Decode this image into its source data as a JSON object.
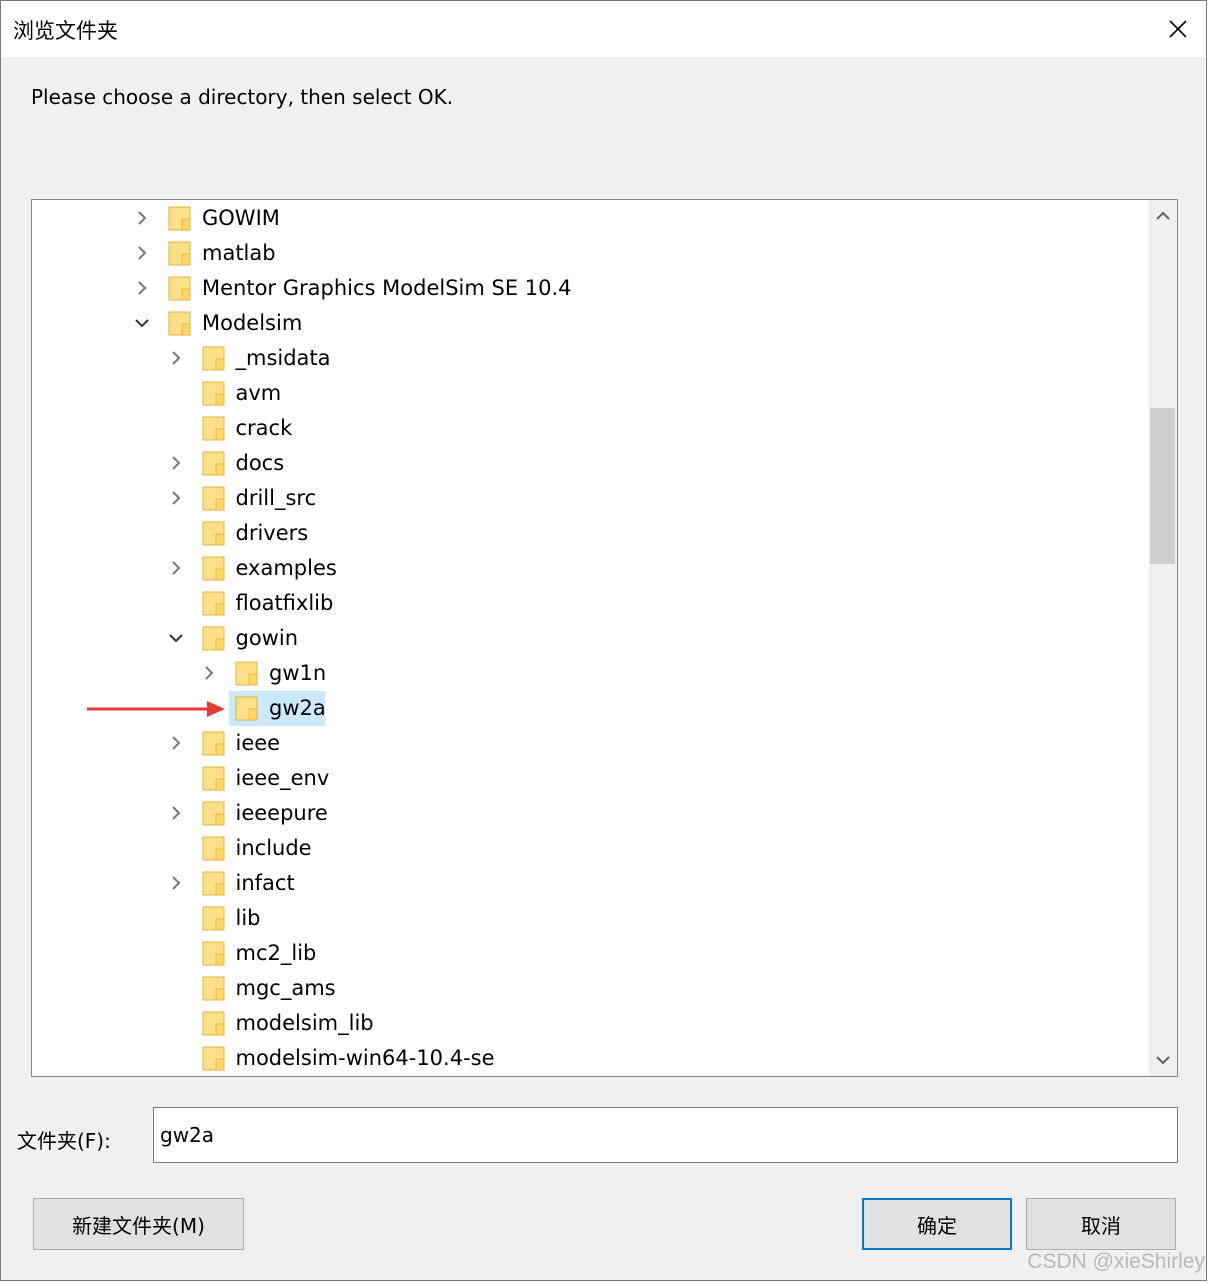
{
  "window": {
    "title": "浏览文件夹",
    "instruction": "Please choose a directory, then select OK."
  },
  "tree": {
    "items": [
      {
        "label": "GOWIM",
        "level": 0,
        "expander": "collapsed",
        "selected": false
      },
      {
        "label": "matlab",
        "level": 0,
        "expander": "collapsed",
        "selected": false
      },
      {
        "label": "Mentor Graphics ModelSim SE 10.4",
        "level": 0,
        "expander": "collapsed",
        "selected": false
      },
      {
        "label": "Modelsim",
        "level": 0,
        "expander": "expanded",
        "selected": false
      },
      {
        "label": "_msidata",
        "level": 1,
        "expander": "collapsed",
        "selected": false
      },
      {
        "label": "avm",
        "level": 1,
        "expander": "none",
        "selected": false
      },
      {
        "label": "crack",
        "level": 1,
        "expander": "none",
        "selected": false
      },
      {
        "label": "docs",
        "level": 1,
        "expander": "collapsed",
        "selected": false
      },
      {
        "label": "drill_src",
        "level": 1,
        "expander": "collapsed",
        "selected": false
      },
      {
        "label": "drivers",
        "level": 1,
        "expander": "none",
        "selected": false
      },
      {
        "label": "examples",
        "level": 1,
        "expander": "collapsed",
        "selected": false
      },
      {
        "label": "floatfixlib",
        "level": 1,
        "expander": "none",
        "selected": false
      },
      {
        "label": "gowin",
        "level": 1,
        "expander": "expanded",
        "selected": false
      },
      {
        "label": "gw1n",
        "level": 2,
        "expander": "collapsed",
        "selected": false
      },
      {
        "label": "gw2a",
        "level": 2,
        "expander": "none",
        "selected": true
      },
      {
        "label": "ieee",
        "level": 1,
        "expander": "collapsed",
        "selected": false
      },
      {
        "label": "ieee_env",
        "level": 1,
        "expander": "none",
        "selected": false
      },
      {
        "label": "ieeepure",
        "level": 1,
        "expander": "collapsed",
        "selected": false
      },
      {
        "label": "include",
        "level": 1,
        "expander": "none",
        "selected": false
      },
      {
        "label": "infact",
        "level": 1,
        "expander": "collapsed",
        "selected": false
      },
      {
        "label": "lib",
        "level": 1,
        "expander": "none",
        "selected": false
      },
      {
        "label": "mc2_lib",
        "level": 1,
        "expander": "none",
        "selected": false
      },
      {
        "label": "mgc_ams",
        "level": 1,
        "expander": "none",
        "selected": false
      },
      {
        "label": "modelsim_lib",
        "level": 1,
        "expander": "none",
        "selected": false
      },
      {
        "label": "modelsim-win64-10.4-se",
        "level": 1,
        "expander": "none",
        "selected": false
      }
    ]
  },
  "folder_field": {
    "label": "文件夹(F):",
    "value": "gw2a"
  },
  "buttons": {
    "new_folder": "新建文件夹(M)",
    "ok": "确定",
    "cancel": "取消"
  },
  "watermark": "CSDN @xieShirley",
  "colors": {
    "selection": "#cce8ff",
    "folder_fill": "#ffe08a",
    "folder_stroke": "#e0b23c",
    "ok_border": "#0078d7",
    "arrow": "#e53935"
  }
}
